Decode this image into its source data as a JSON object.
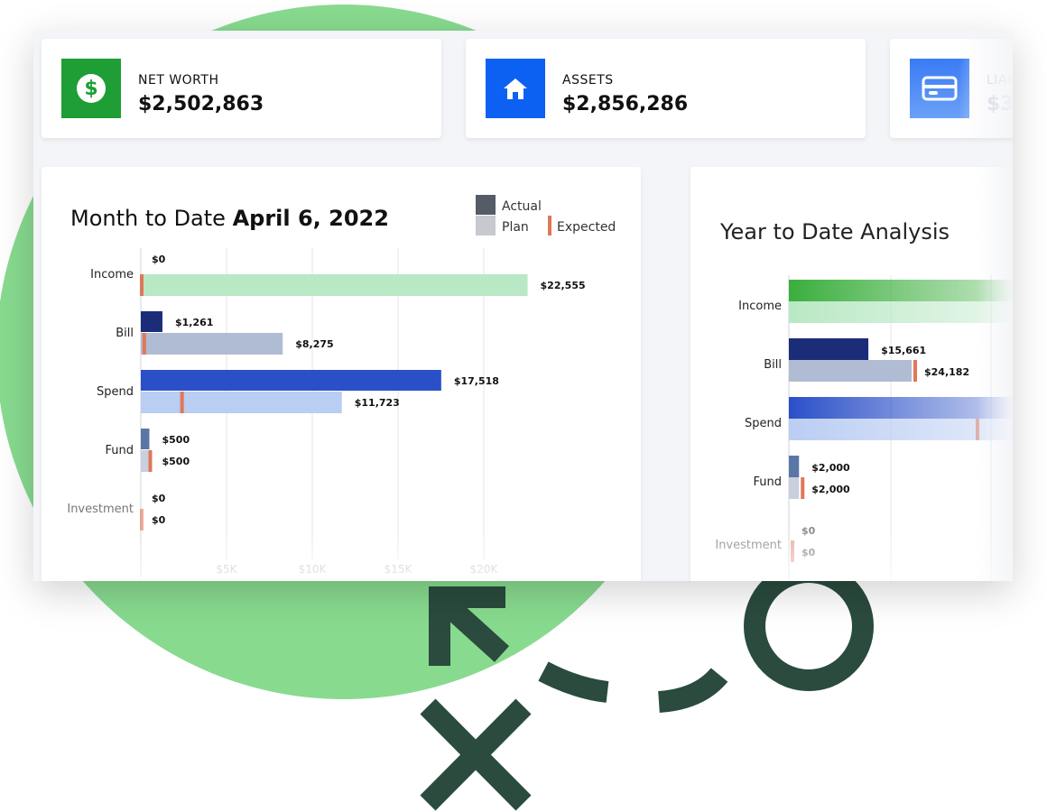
{
  "cards": [
    {
      "label": "NET WORTH",
      "value": "$2,502,863",
      "icon": "dollar-icon",
      "color": "#1e9e35"
    },
    {
      "label": "ASSETS",
      "value": "$2,856,286",
      "icon": "home-icon",
      "color": "#0d61f2"
    },
    {
      "label": "LIAB",
      "value": "$3",
      "icon": "credit-card-icon",
      "color": "#3a7bf5"
    }
  ],
  "month_chart": {
    "title_prefix": "Month to Date ",
    "title_date": "April 6, 2022",
    "legend": {
      "actual": "Actual",
      "plan": "Plan",
      "expected": "Expected"
    }
  },
  "year_chart": {
    "title": "Year to Date Analysis"
  },
  "colors": {
    "green_circle": "#88da8f",
    "deco_dark": "#2a4b3d",
    "expected": "#e0775a",
    "income_plan": "#b9e8c4",
    "bill_actual": "#1b2d78",
    "bill_plan": "#b0bcd3",
    "spend_actual": "#2a4fc8",
    "spend_plan": "#bacdf3",
    "fund_actual": "#5a76a6",
    "fund_plan": "#c9cfdc"
  },
  "chart_data": [
    {
      "type": "bar",
      "title": "Month to Date April 6, 2022",
      "categories": [
        "Income",
        "Bill",
        "Spend",
        "Fund",
        "Investment"
      ],
      "series": [
        {
          "name": "Actual",
          "values": [
            0,
            1261,
            17518,
            500,
            0
          ],
          "labels": [
            "$0",
            "$1,261",
            "$17,518",
            "$500",
            "$0"
          ]
        },
        {
          "name": "Plan",
          "values": [
            22555,
            8275,
            11723,
            500,
            0
          ],
          "labels": [
            "$22,555",
            "$8,275",
            "$11,723",
            "$500",
            "$0"
          ]
        },
        {
          "name": "Expected",
          "values": [
            0,
            150,
            2350,
            500,
            0
          ]
        }
      ],
      "xlim": [
        0,
        25000
      ],
      "xticks": [
        5000,
        10000,
        15000,
        20000
      ],
      "xtick_labels": [
        "$5K",
        "$10K",
        "$15K",
        "$20K"
      ],
      "orientation": "horizontal",
      "legend": "top-right"
    },
    {
      "type": "bar",
      "title": "Year to Date Analysis",
      "categories": [
        "Income",
        "Bill",
        "Spend",
        "Fund",
        "Investment"
      ],
      "series": [
        {
          "name": "Actual",
          "values": [
            null,
            15661,
            null,
            2000,
            0
          ],
          "labels": [
            "",
            "$15,661",
            "",
            "$2,000",
            "$0"
          ]
        },
        {
          "name": "Plan",
          "values": [
            null,
            24182,
            null,
            2000,
            0
          ],
          "labels": [
            "",
            "$24,182",
            "",
            "$2,000",
            "$0"
          ]
        }
      ],
      "orientation": "horizontal"
    }
  ]
}
